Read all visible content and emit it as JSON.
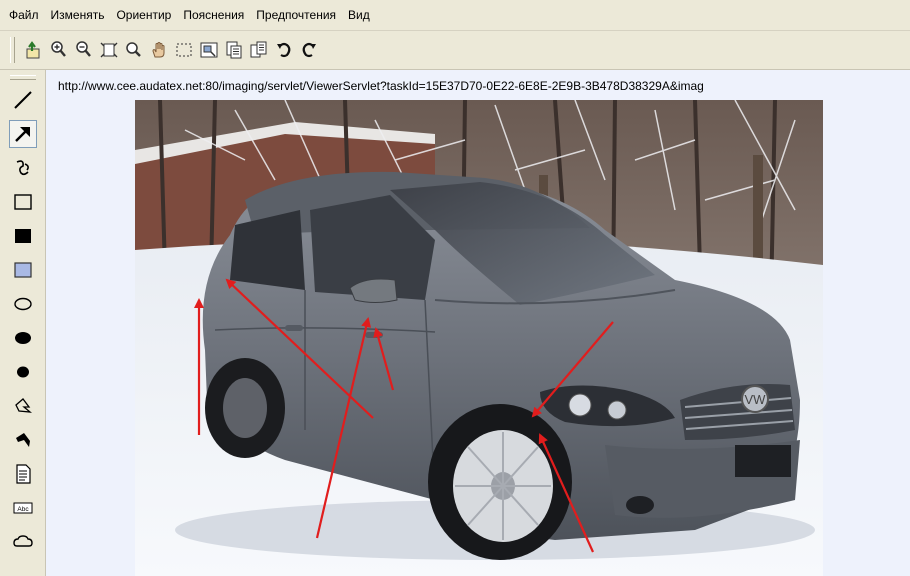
{
  "menu": {
    "items": [
      "Файл",
      "Изменять",
      "Ориентир",
      "Пояснения",
      "Предпочтения",
      "Вид"
    ]
  },
  "toolbar": {
    "buttons": [
      {
        "name": "export-icon"
      },
      {
        "name": "zoom-in-icon"
      },
      {
        "name": "zoom-out-icon"
      },
      {
        "name": "fit-page-icon"
      },
      {
        "name": "magnifier-icon"
      },
      {
        "name": "pan-hand-icon"
      },
      {
        "name": "select-area-icon"
      },
      {
        "name": "fit-window-icon"
      },
      {
        "name": "thumbnails-icon"
      },
      {
        "name": "copy-pages-icon"
      },
      {
        "name": "rotate-left-icon"
      },
      {
        "name": "rotate-right-icon"
      }
    ]
  },
  "left_tools": [
    {
      "name": "line-tool-icon"
    },
    {
      "name": "arrow-tool-icon",
      "active": true
    },
    {
      "name": "freehand-tool-icon"
    },
    {
      "name": "rectangle-tool-icon"
    },
    {
      "name": "filled-rectangle-tool-icon"
    },
    {
      "name": "highlight-rectangle-tool-icon"
    },
    {
      "name": "ellipse-tool-icon"
    },
    {
      "name": "filled-ellipse-tool-icon"
    },
    {
      "name": "small-filled-ellipse-tool-icon"
    },
    {
      "name": "polygon-tool-icon"
    },
    {
      "name": "filled-polygon-tool-icon"
    },
    {
      "name": "note-tool-icon"
    },
    {
      "name": "text-tool-icon"
    },
    {
      "name": "cloud-tool-icon"
    }
  ],
  "viewer": {
    "url": "http://www.cee.audatex.net:80/imaging/servlet/ViewerServlet?taskId=15E37D70-0E22-6E8E-2E9B-3B478D38329A&imag",
    "photo_description_icon": "damaged-car-photo",
    "annotation_color": "#e11d1d",
    "text_tool_label": "Abc"
  }
}
